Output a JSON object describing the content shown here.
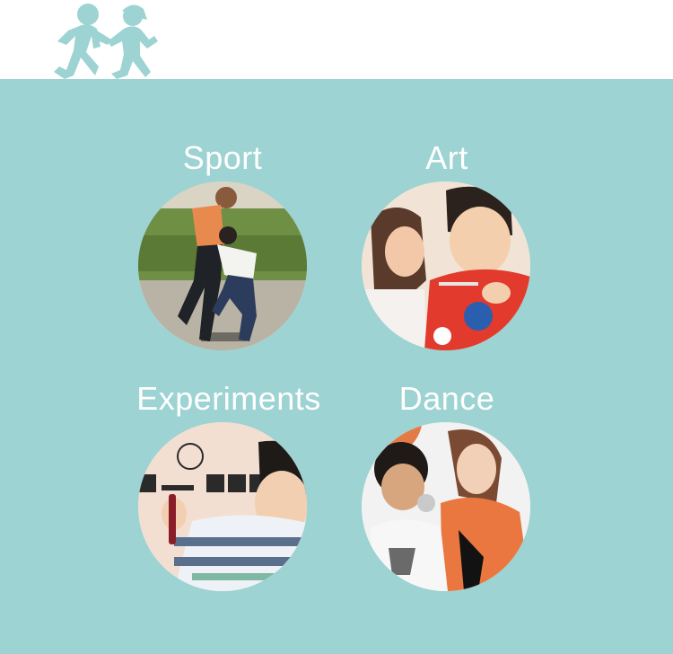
{
  "brand": {
    "logo_icon": "running-kids-icon",
    "logo_color": "#9dd3d2"
  },
  "panel": {
    "background": "#9dd3d2"
  },
  "activities": [
    {
      "label": "Sport",
      "image": "sport-photo"
    },
    {
      "label": "Art",
      "image": "art-photo"
    },
    {
      "label": "Experiments",
      "image": "experiments-photo"
    },
    {
      "label": "Dance",
      "image": "dance-photo"
    }
  ]
}
